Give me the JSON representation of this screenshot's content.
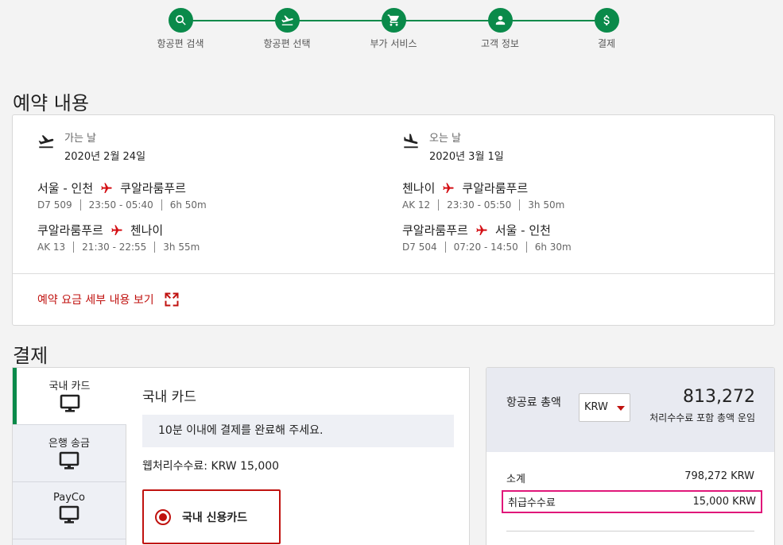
{
  "steps": [
    {
      "label": "항공편 검색",
      "icon": "search-icon"
    },
    {
      "label": "항공편 선택",
      "icon": "plane-takeoff-icon"
    },
    {
      "label": "부가 서비스",
      "icon": "cart-icon"
    },
    {
      "label": "고객 정보",
      "icon": "user-icon"
    },
    {
      "label": "결제",
      "icon": "dollar-icon"
    }
  ],
  "reservation": {
    "title": "예약 내용",
    "outbound": {
      "kind": "가는 날",
      "date": "2020년 2월 24일",
      "routes": [
        {
          "from": "서울 - 인천",
          "to": "쿠알라룸푸르",
          "flight": "D7 509",
          "time": "23:50 - 05:40",
          "duration": "6h 50m"
        },
        {
          "from": "쿠알라룸푸르",
          "to": "첸나이",
          "flight": "AK 13",
          "time": "21:30 - 22:55",
          "duration": "3h 55m"
        }
      ]
    },
    "inbound": {
      "kind": "오는 날",
      "date": "2020년 3월 1일",
      "routes": [
        {
          "from": "첸나이",
          "to": "쿠알라룸푸르",
          "flight": "AK 12",
          "time": "23:30 - 05:50",
          "duration": "3h 50m"
        },
        {
          "from": "쿠알라룸푸르",
          "to": "서울 - 인천",
          "flight": "D7 504",
          "time": "07:20 - 14:50",
          "duration": "6h 30m"
        }
      ]
    },
    "fare_link": "예약 요금 세부 내용 보기"
  },
  "payment": {
    "title": "결제",
    "tabs": [
      {
        "label": "국내 카드",
        "active": true
      },
      {
        "label": "은행 송금",
        "active": false
      },
      {
        "label": "PayCo",
        "active": false
      }
    ],
    "panel_title": "국내 카드",
    "notice": "10분 이내에 결제를 완료해 주세요.",
    "web_fee": "웹처리수수료: KRW 15,000",
    "option_label": "국내 신용카드"
  },
  "summary": {
    "total_label": "항공료 총액",
    "currency": "KRW",
    "total_amount": "813,272",
    "total_sub": "처리수수료 포함 총액 운임",
    "subtotal_label": "소계",
    "subtotal_value": "798,272 KRW",
    "fee_label": "취급수수료",
    "fee_value": "15,000 KRW"
  },
  "colors": {
    "accent_green": "#0a8a4a",
    "accent_red": "#c0120f",
    "highlight_pink": "#e0177a"
  }
}
